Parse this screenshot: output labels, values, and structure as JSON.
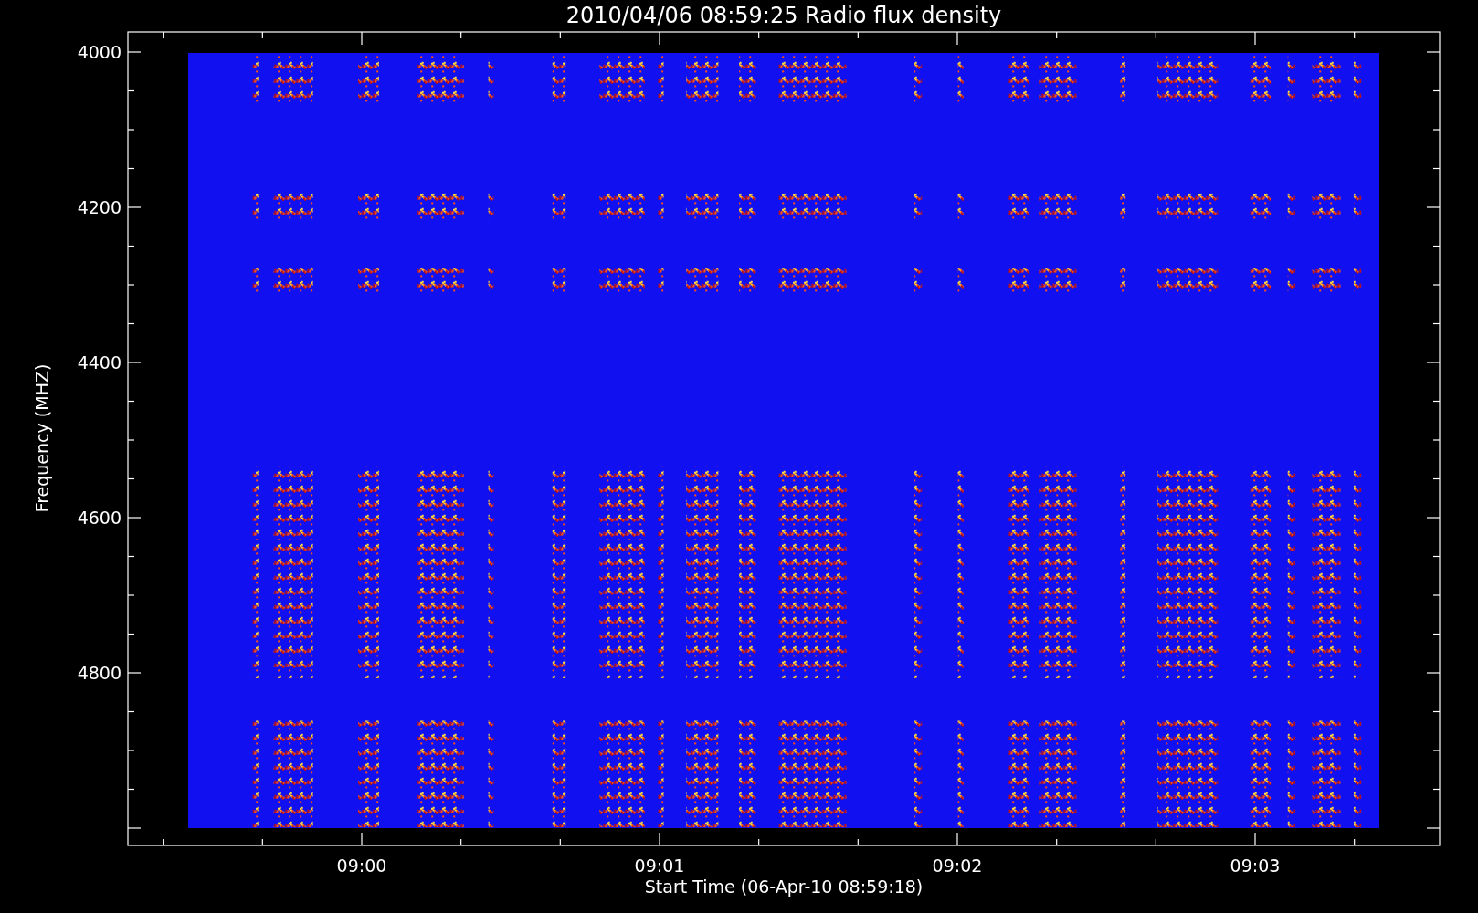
{
  "title": "2010/04/06 08:59:25 Radio flux density",
  "y_axis": {
    "label": "Frequency (MHZ)",
    "ticks": [
      "4000",
      "4200",
      "4400",
      "4600",
      "4800"
    ]
  },
  "x_axis": {
    "label": "Start Time (06-Apr-10 08:59:18)",
    "ticks": [
      "09:00",
      "09:01",
      "09:02",
      "09:03"
    ]
  }
}
